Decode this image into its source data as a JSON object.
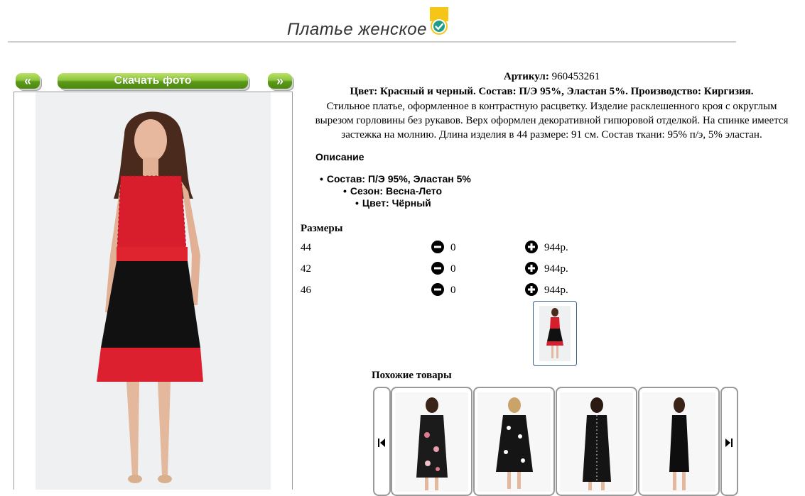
{
  "page": {
    "title": "Платье женское",
    "badge_icon": "verified-check-icon"
  },
  "photo_panel": {
    "prev_label": "«",
    "next_label": "»",
    "download_label": "Скачать фото"
  },
  "product": {
    "article_label": "Артикул:",
    "article_value": "960453261",
    "color_line": "Цвет: Красный и черный. Состав: П/Э 95%, Эластан 5%. Производство: Киргизия.",
    "description_lines": [
      "Стильное платье, оформленное в контрастную расцветку. Изделие расклешенного кроя с округлым",
      "вырезом горловины без рукавов. Верх оформлен декоративной гипюровой отделкой. На спинке имеется",
      "застежка на молнию. Длина изделия в 44 размере: 91 см. Состав ткани: 95% п/э, 5% эластан."
    ],
    "description_heading": "Описание",
    "properties": [
      "Состав: П/Э 95%, Эластан 5%",
      "Сезон: Весна-Лето",
      "Цвет: Чёрный"
    ]
  },
  "sizes": {
    "heading": "Размеры",
    "rows": [
      {
        "size": "44",
        "qty": "0",
        "price": "944р."
      },
      {
        "size": "42",
        "qty": "0",
        "price": "944р."
      },
      {
        "size": "46",
        "qty": "0",
        "price": "944р."
      }
    ],
    "minus_icon": "minus-circle-icon",
    "plus_icon": "plus-circle-icon"
  },
  "similar": {
    "heading": "Похожие товары",
    "prev_icon": "skip-previous-icon",
    "next_icon": "skip-next-icon",
    "item_count": 4
  },
  "colors": {
    "button_green": "#6aaa1f",
    "dress_red": "#d81e2c",
    "badge_yellow": "#f5c518",
    "badge_teal": "#1e9e8a"
  }
}
